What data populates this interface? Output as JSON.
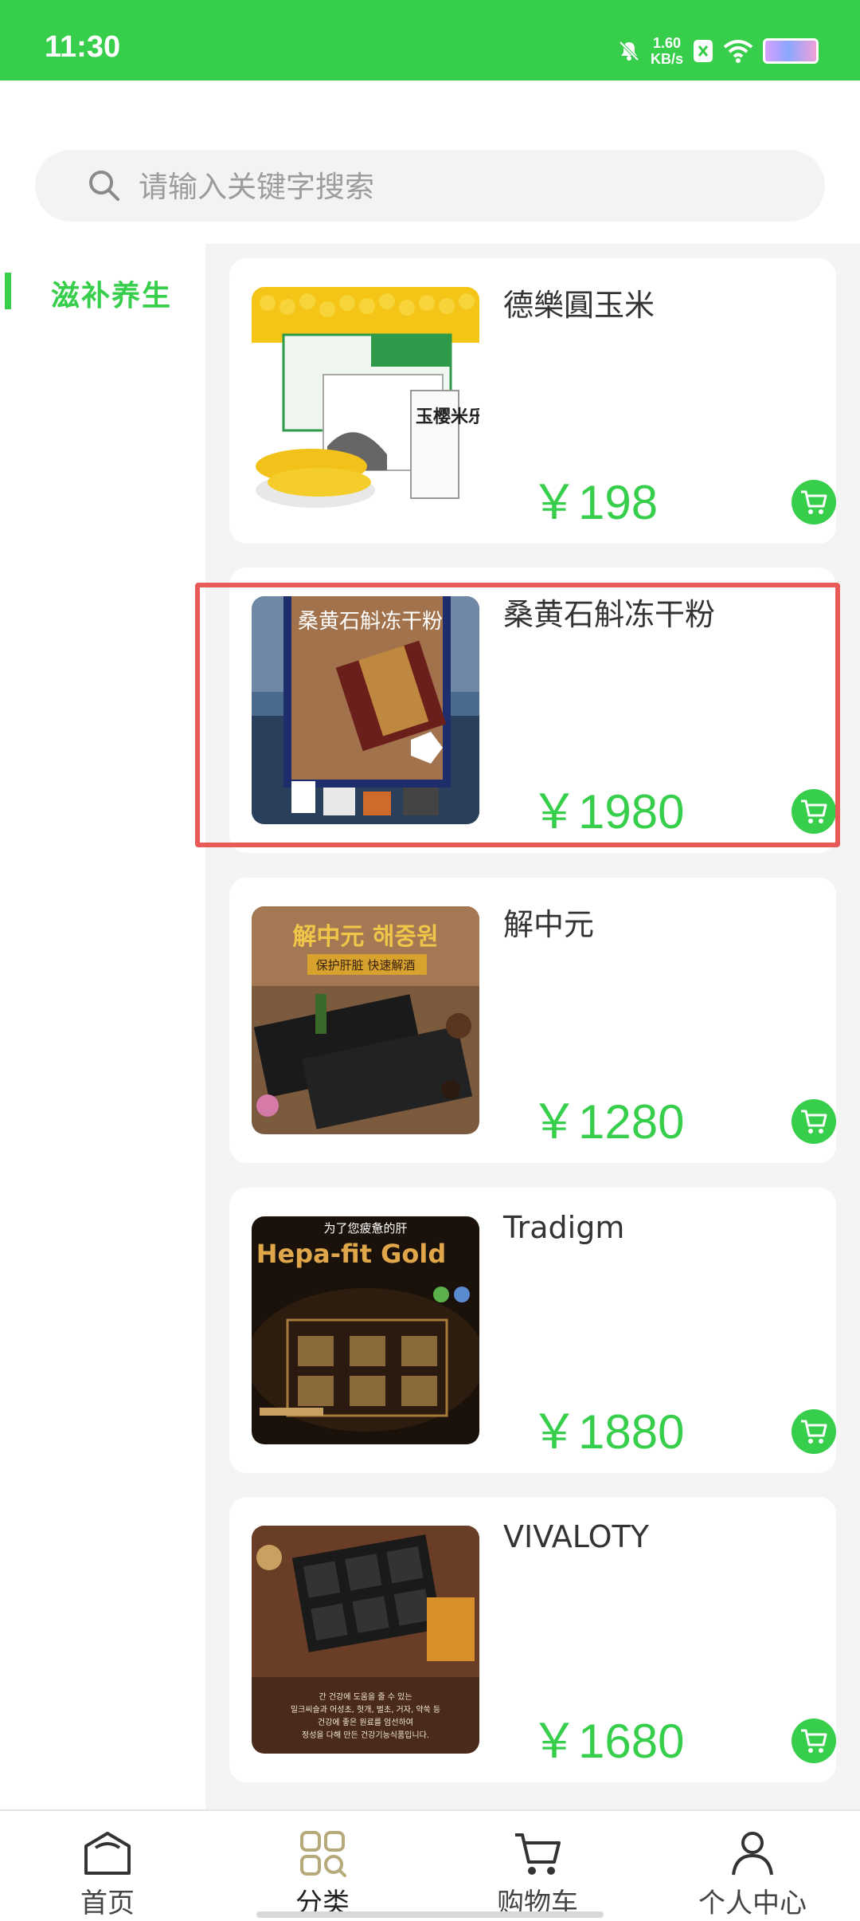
{
  "status_bar": {
    "time": "11:30",
    "net_speed_value": "1.60",
    "net_speed_unit": "KB/s",
    "icons": [
      "mute-icon",
      "x-badge-icon",
      "wifi-icon",
      "battery-icon"
    ]
  },
  "search": {
    "placeholder": "请输入关键字搜索"
  },
  "sidebar": {
    "categories": [
      {
        "label": "滋补养生",
        "selected": true
      }
    ]
  },
  "products": [
    {
      "name": "德樂圓玉米",
      "price": "￥198"
    },
    {
      "name": "桑黄石斛冻干粉",
      "price": "￥1980"
    },
    {
      "name": "解中元",
      "price": "￥1280"
    },
    {
      "name": "Tradigm",
      "price": "￥1880"
    },
    {
      "name": "VIVALOTY",
      "price": "￥1680"
    }
  ],
  "product_image_text": {
    "p1": {
      "box_text": "玉樱米乐"
    },
    "p2": {
      "box_text": "桑黄石斛冻干粉"
    },
    "p3": {
      "title": "解中元 해중원",
      "subtitle": "保护肝脏  快速解酒"
    },
    "p4": {
      "caption": "为了您疲惫的肝",
      "title": "Hepa-fit Gold"
    },
    "p5": {
      "caption_lines": [
        "간 건강에 도움을 줄 수 있는",
        "밀크씨슬과 어성초, 헛개, 벌초, 거자, 약쑥 등",
        "건강에 좋은 원료를 엄선하여",
        "정성을 다해 만든 건강기능식품입니다."
      ]
    }
  },
  "tab_bar": {
    "tabs": [
      {
        "label": "首页",
        "icon": "home-icon"
      },
      {
        "label": "分类",
        "icon": "grid-icon",
        "active": true
      },
      {
        "label": "购物车",
        "icon": "cart-icon"
      },
      {
        "label": "个人中心",
        "icon": "user-icon"
      }
    ]
  },
  "colors": {
    "accent": "#36ce4a",
    "highlight": "#e85a57",
    "background_gray": "#f4f4f4"
  }
}
